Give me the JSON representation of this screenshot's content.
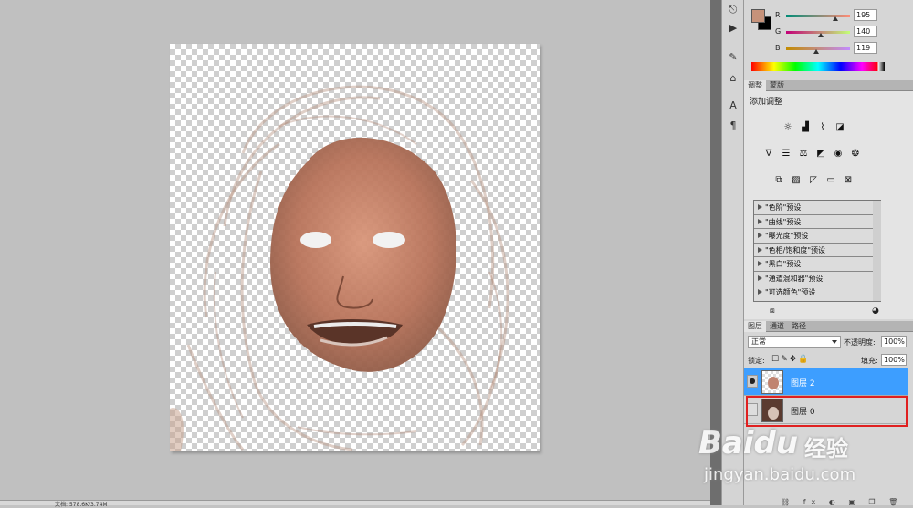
{
  "color_panel": {
    "fg_color": "#c6927a",
    "bg_color": "#000000",
    "channels": [
      {
        "label": "R",
        "value": "195",
        "fraction": 0.765
      },
      {
        "label": "G",
        "value": "140",
        "fraction": 0.549
      },
      {
        "label": "B",
        "value": "119",
        "fraction": 0.467
      }
    ]
  },
  "adjustments": {
    "tabs": [
      {
        "label": "调整"
      },
      {
        "label": "蒙版"
      }
    ],
    "title": "添加调整",
    "presets": [
      {
        "label": "\"色阶\"预设"
      },
      {
        "label": "\"曲线\"预设"
      },
      {
        "label": "\"曝光度\"预设"
      },
      {
        "label": "\"色相/饱和度\"预设"
      },
      {
        "label": "\"黑白\"预设"
      },
      {
        "label": "\"通道混和器\"预设"
      },
      {
        "label": "\"可选颜色\"预设"
      }
    ]
  },
  "layers": {
    "tabs": [
      {
        "label": "图层"
      },
      {
        "label": "通道"
      },
      {
        "label": "路径"
      }
    ],
    "blend_mode": "正常",
    "opacity_label": "不透明度:",
    "opacity_value": "100%",
    "lock_label": "锁定:",
    "fill_label": "填充:",
    "fill_value": "100%",
    "items": [
      {
        "name": "图层 2",
        "selected": true,
        "visible": true
      },
      {
        "name": "图层 0",
        "selected": false,
        "visible": false
      }
    ]
  },
  "statusbar": {
    "text": "文档: 578.6K/3.74M"
  },
  "watermark": {
    "logo": "Baidu",
    "cn": "经验",
    "url": "jingyan.baidu.com"
  },
  "colors": {
    "selection": "#3d9eff",
    "highlight_border": "#e02020"
  }
}
